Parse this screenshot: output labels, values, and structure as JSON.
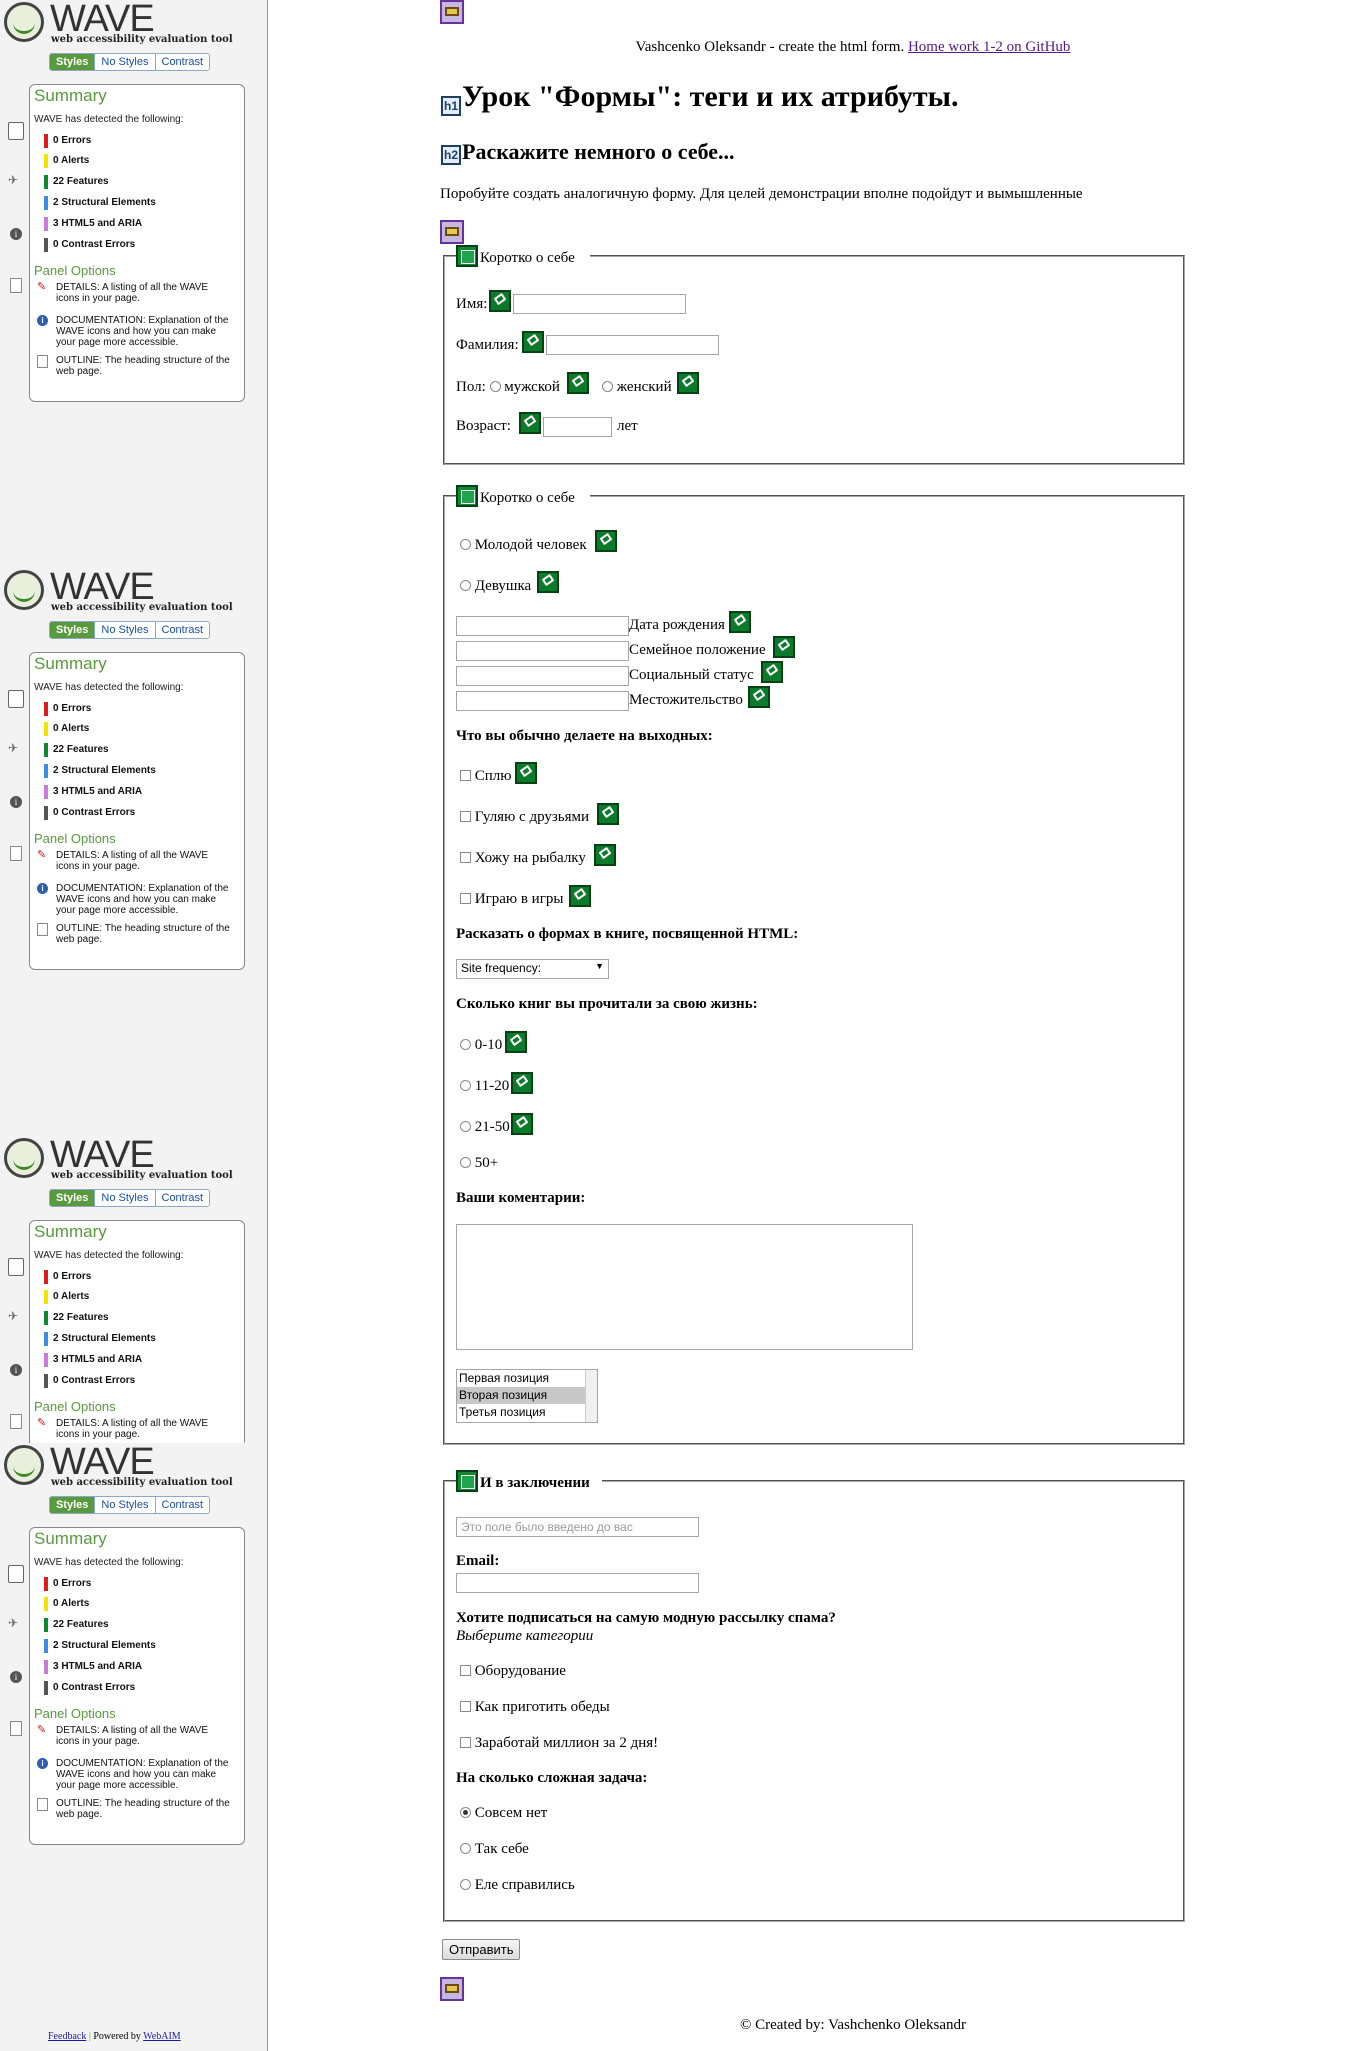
{
  "wave": {
    "logo_text": "WAVE",
    "subtitle": "web accessibility evaluation tool",
    "tabs": [
      "Styles",
      "No Styles",
      "Contrast"
    ],
    "summary_title": "Summary",
    "detected": "WAVE has detected the following:",
    "counts": [
      {
        "label": "0 Errors",
        "color": "#e01b1b"
      },
      {
        "label": "0 Alerts",
        "color": "#f2e300"
      },
      {
        "label": "22 Features",
        "color": "#0c8a2c"
      },
      {
        "label": "2 Structural Elements",
        "color": "#3b8de0"
      },
      {
        "label": "3 HTML5 and ARIA",
        "color": "#c77cd4"
      },
      {
        "label": "0 Contrast Errors",
        "color": "#555555"
      }
    ],
    "panel_options": "Panel Options",
    "options": [
      {
        "label": "DETAILS: A listing of all the WAVE icons in your page.",
        "icon": "pen-icon"
      },
      {
        "label": "DOCUMENTATION: Explanation of the WAVE icons and how you can make your page more accessible.",
        "icon": "info-icon"
      },
      {
        "label": "OUTLINE: The heading structure of the web page.",
        "icon": "document-icon"
      }
    ],
    "footer_feedback": "Feedback",
    "footer_powered": "Powered by",
    "footer_webaim": "WebAIM"
  },
  "page": {
    "intro_text": "Vashcenko Oleksandr - create the html form.",
    "intro_link": "Home work 1-2 on GitHub",
    "h1": "Урок \"Формы\": теги и их атрибуты.",
    "h2": "Раскажите немного о себе...",
    "lead": "Поробуйте создать аналогичную форму. Для целей демонстрации вполне подойдут и вымышленные",
    "h1_tag": "h1",
    "h2_tag": "h2",
    "fs1": {
      "legend": "Коротко о себе",
      "name_label": "Имя:",
      "surname_label": "Фамилия:",
      "gender_label": "Пол:",
      "male": "мужской",
      "female": "женский",
      "age_label": "Возраст:",
      "age_unit": "лет"
    },
    "fs2": {
      "legend": "Коротко о себе",
      "young_man": "Молодой человек",
      "girl": "Девушка",
      "fields": [
        "Дата рождения",
        "Семейное положение",
        "Социальный статус",
        "Местожительство"
      ],
      "weekend_q": "Что вы обычно делаете на выходных:",
      "weekend": [
        "Сплю",
        "Гуляю с друзьями",
        "Хожу на рыбалку",
        "Играю в игры"
      ],
      "book_q": "Расказать о формах в книге, посвященной HTML:",
      "select_value": "Site frequency:",
      "books_q": "Сколько книг вы прочитали за свою жизнь:",
      "books": [
        "0-10",
        "11-20",
        "21-50",
        "50+"
      ],
      "comments_q": "Ваши коментарии:",
      "list": [
        "Первая позиция",
        "Вторая позиция",
        "Третья позиция"
      ]
    },
    "fs3": {
      "legend": "И в заключении",
      "placeholder": "Это поле было введено до вас",
      "email_label": "Email:",
      "spam_q": "Хотите подписаться на самую модную рассылку спама?",
      "spam_hint": "Выберите категории",
      "cats": [
        "Оборудование",
        "Как приготить обеды",
        "Заработай миллион за 2 дня!"
      ],
      "diff_q": "На сколько сложная задача:",
      "diffs": [
        "Совсем нет",
        "Так себе",
        "Еле справились"
      ]
    },
    "submit": "Отправить",
    "footer": "© Created by: Vashchenko Oleksandr"
  }
}
